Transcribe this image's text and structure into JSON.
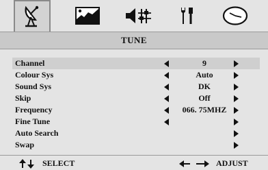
{
  "tabs": [
    {
      "icon": "satellite-dish-icon",
      "selected": true
    },
    {
      "icon": "picture-icon",
      "selected": false
    },
    {
      "icon": "speaker-equalizer-icon",
      "selected": false
    },
    {
      "icon": "tools-icon",
      "selected": false
    },
    {
      "icon": "clock-icon",
      "selected": false
    }
  ],
  "title": "TUNE",
  "menu": [
    {
      "label": "Channel",
      "value": "9",
      "arrows": "both"
    },
    {
      "label": "Colour Sys",
      "value": "Auto",
      "arrows": "both"
    },
    {
      "label": "Sound Sys",
      "value": "DK",
      "arrows": "both"
    },
    {
      "label": "Skip",
      "value": "Off",
      "arrows": "both"
    },
    {
      "label": "Frequency",
      "value": "066. 75MHZ",
      "arrows": "both"
    },
    {
      "label": "Fine Tune",
      "value": "",
      "arrows": "both"
    },
    {
      "label": "Auto Search",
      "value": "",
      "arrows": "right"
    },
    {
      "label": "Swap",
      "value": "",
      "arrows": "right"
    }
  ],
  "selected_index": 0,
  "footer": {
    "select_label": "SELECT",
    "adjust_label": "ADJUST"
  },
  "colors": {
    "background": "#e4e4e4",
    "title_bar": "#c9c9c9",
    "selected_row": "#cfcfcf",
    "text": "#111111"
  }
}
